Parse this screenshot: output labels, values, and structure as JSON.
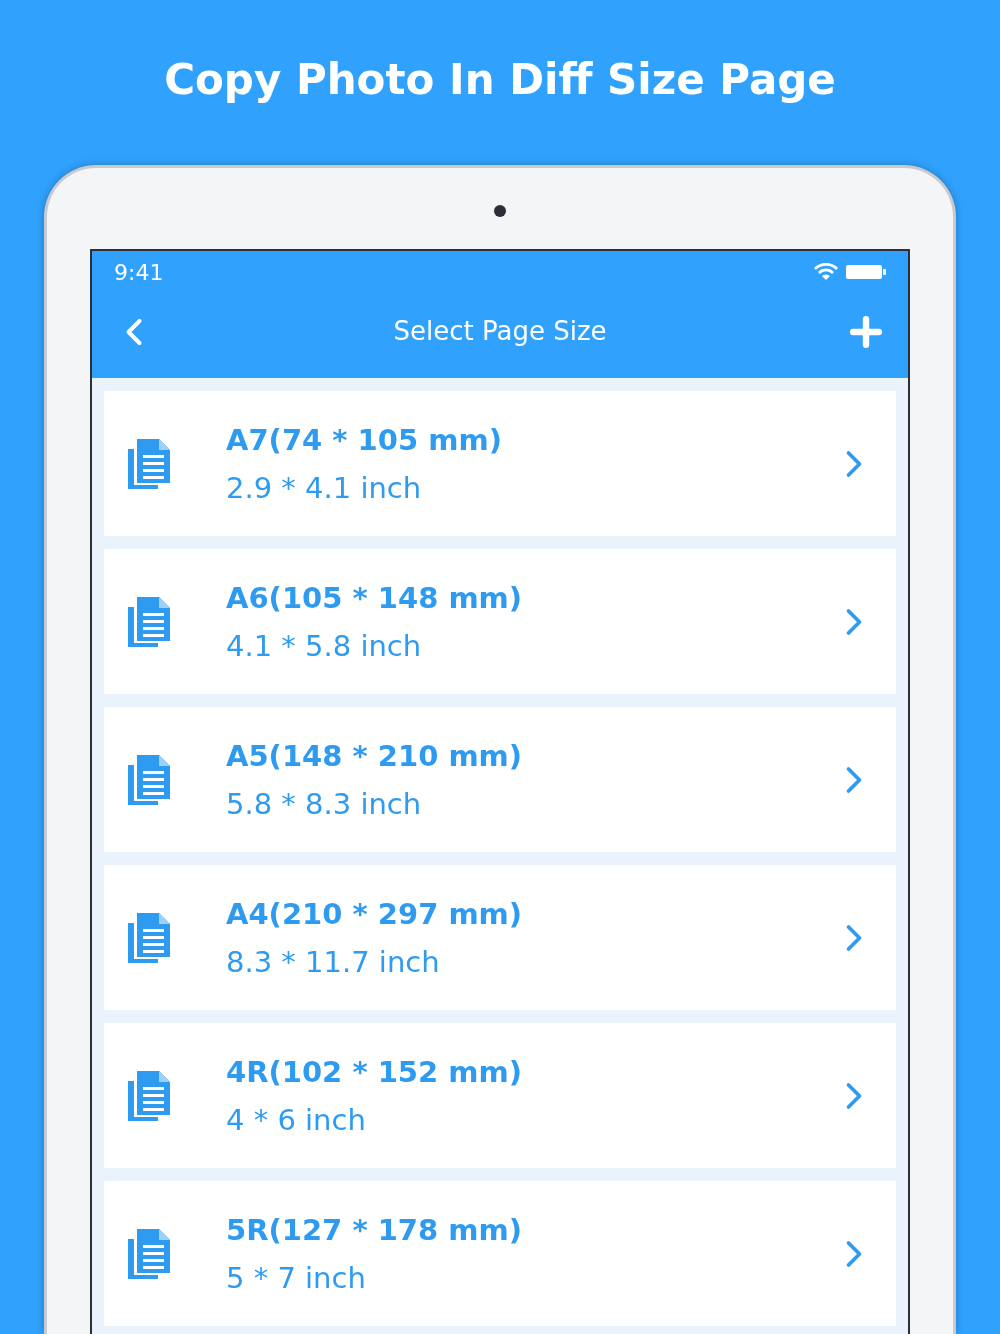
{
  "headline": "Copy Photo In Diff Size Page",
  "status_bar": {
    "time": "9:41"
  },
  "nav_bar": {
    "title": "Select Page Size"
  },
  "page_sizes": [
    {
      "title": "A7(74 * 105 mm)",
      "subtitle": "2.9 * 4.1 inch"
    },
    {
      "title": "A6(105 * 148 mm)",
      "subtitle": "4.1 * 5.8 inch"
    },
    {
      "title": "A5(148 * 210 mm)",
      "subtitle": "5.8 * 8.3 inch"
    },
    {
      "title": "A4(210 * 297 mm)",
      "subtitle": "8.3 * 11.7 inch"
    },
    {
      "title": "4R(102 * 152 mm)",
      "subtitle": "4 * 6 inch"
    },
    {
      "title": "5R(127 * 178 mm)",
      "subtitle": "5 * 7 inch"
    }
  ]
}
